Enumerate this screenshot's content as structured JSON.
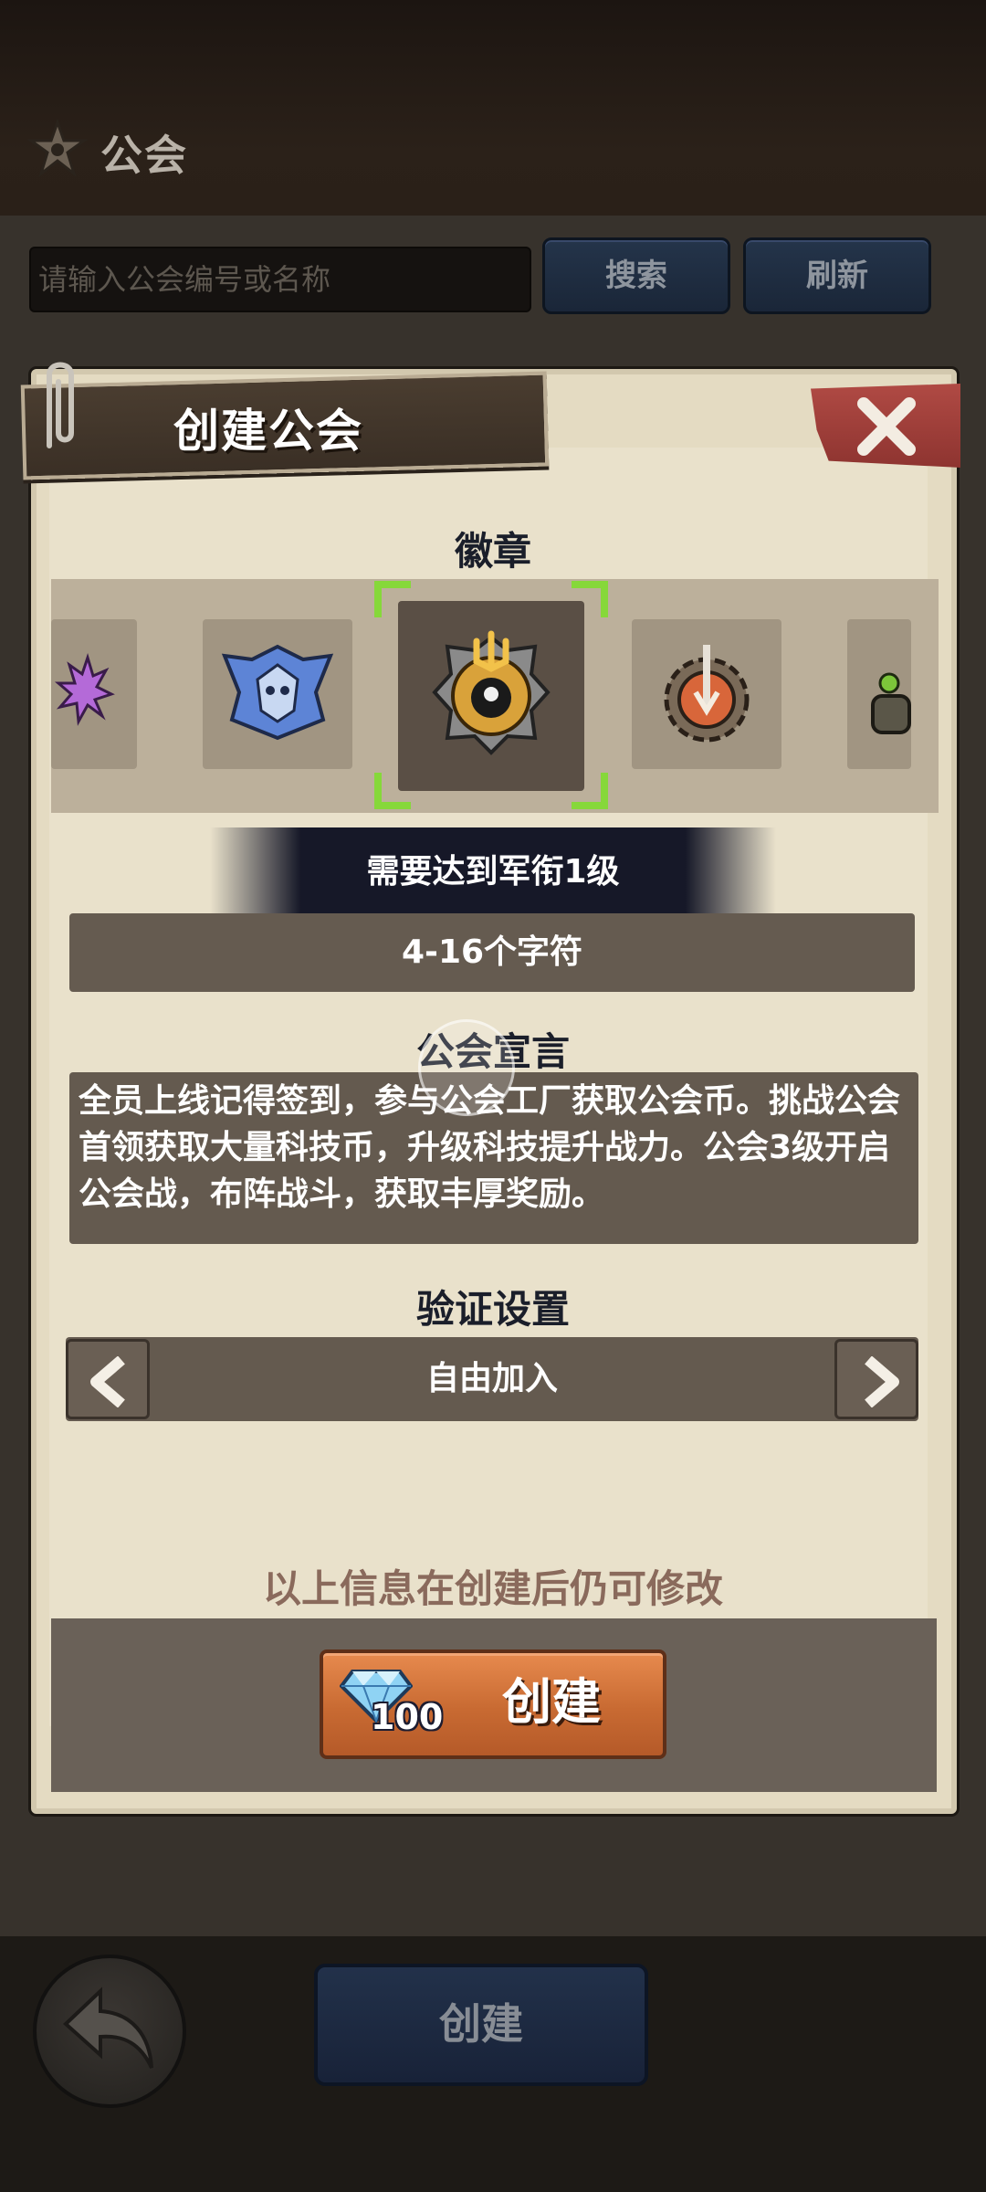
{
  "header": {
    "title": "公会",
    "icon": "gear-star-icon"
  },
  "search": {
    "placeholder": "请输入公会编号或名称",
    "search_label": "搜索",
    "refresh_label": "刷新"
  },
  "dialog": {
    "title": "创建公会",
    "close_icon": "close-icon",
    "badge_section_label": "徽章",
    "badges": [
      "purple-spiky-badge",
      "blue-winged-badge",
      "golden-trident-badge",
      "red-sword-gear-badge",
      "green-mech-badge"
    ],
    "selected_badge_index": 2,
    "requirement": "需要达到军衔1级",
    "name_field_hint": "4-16个字符",
    "declaration_label": "公会宣言",
    "declaration_text": "全员上线记得签到，参与公会工厂获取公会币。挑战公会首领获取大量科技币，升级科技提升战力。公会3级开启公会战，布阵战斗，获取丰厚奖励。",
    "verify_label": "验证设置",
    "verify_value": "自由加入",
    "hint": "以上信息在创建后仍可修改",
    "create_cost": "100",
    "create_label": "创建"
  },
  "bottom": {
    "create_label": "创建"
  },
  "colors": {
    "accent_orange": "#c86a32",
    "panel": "#e4dbc2",
    "selector_green": "#86d83a"
  }
}
